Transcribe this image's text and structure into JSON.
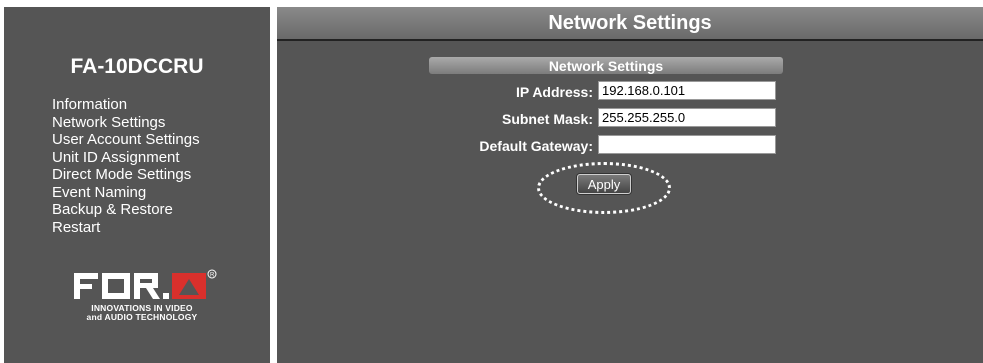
{
  "sidebar": {
    "device_name": "FA-10DCCRU",
    "menu": [
      {
        "label": "Information"
      },
      {
        "label": "Network Settings"
      },
      {
        "label": "User Account Settings"
      },
      {
        "label": "Unit ID Assignment"
      },
      {
        "label": "Direct Mode Settings"
      },
      {
        "label": "Event Naming"
      },
      {
        "label": "Backup & Restore"
      },
      {
        "label": "Restart"
      }
    ],
    "logo": {
      "brand": "FOR-A",
      "tagline_1": "INNOVATIONS IN VIDEO",
      "tagline_2": "and AUDIO TECHNOLOGY"
    }
  },
  "main": {
    "title": "Network Settings",
    "panel_title": "Network Settings",
    "fields": {
      "ip_address": {
        "label": "IP Address:",
        "value": "192.168.0.101"
      },
      "subnet_mask": {
        "label": "Subnet Mask:",
        "value": "255.255.255.0"
      },
      "default_gateway": {
        "label": "Default Gateway:",
        "value": ""
      }
    },
    "apply_label": "Apply"
  },
  "colors": {
    "panel_bg": "#555555",
    "logo_accent": "#d9302c"
  }
}
